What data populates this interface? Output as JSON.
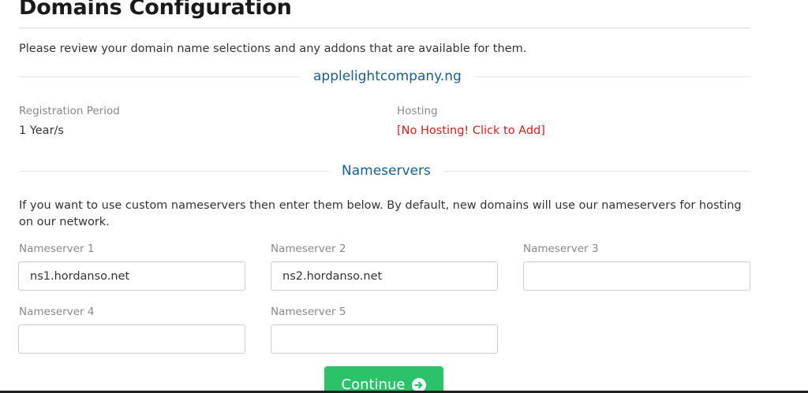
{
  "page": {
    "title": "Domains Configuration",
    "intro": "Please review your domain name selections and any addons that are available for them."
  },
  "domain": {
    "name": "applelightcompany.ng",
    "registration_period_label": "Registration Period",
    "registration_period_value": "1 Year/s",
    "hosting_label": "Hosting",
    "hosting_link": "[No Hosting! Click to Add]"
  },
  "nameservers": {
    "heading": "Nameservers",
    "intro": "If you want to use custom nameservers then enter them below. By default, new domains will use our nameservers for hosting on our network.",
    "fields": [
      {
        "label": "Nameserver 1",
        "value": "ns1.hordanso.net"
      },
      {
        "label": "Nameserver 2",
        "value": "ns2.hordanso.net"
      },
      {
        "label": "Nameserver 3",
        "value": ""
      },
      {
        "label": "Nameserver 4",
        "value": ""
      },
      {
        "label": "Nameserver 5",
        "value": ""
      }
    ]
  },
  "actions": {
    "continue_label": "Continue",
    "continue_icon": "arrow-circle-right-icon"
  },
  "colors": {
    "heading_blue": "#1c5c8c",
    "link_red": "#cc1f1f",
    "button_green": "#2bc26a"
  }
}
